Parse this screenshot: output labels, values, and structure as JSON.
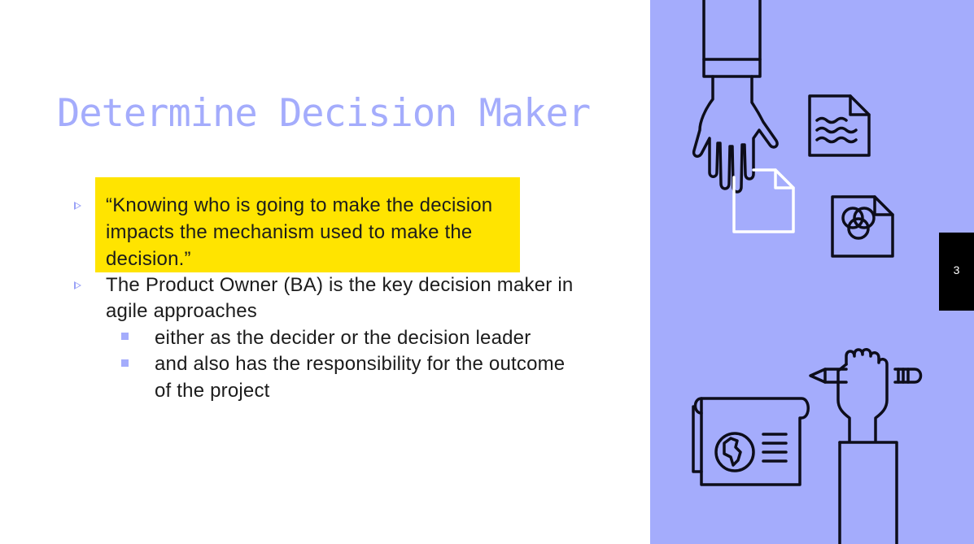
{
  "slide": {
    "title": "Determine Decision Maker",
    "page_number": "3",
    "bullets": [
      {
        "lines": [
          "“Knowing who is going to make the decision",
          "impacts the mechanism used to make the",
          "decision.”"
        ],
        "highlighted": true
      },
      {
        "lines": [
          "The Product Owner (BA) is the key decision maker in",
          "agile approaches"
        ],
        "highlighted": false,
        "sub_bullets": [
          {
            "lines": [
              "either as the decider or the decision leader"
            ]
          },
          {
            "lines": [
              "and also has the responsibility for the outcome",
              "of the project"
            ]
          }
        ]
      }
    ]
  },
  "colors": {
    "accent": "#a4acfc",
    "highlight": "#ffe400",
    "page_box": "#000000"
  },
  "icons": [
    "hand-reaching-icon",
    "document-icon",
    "blank-page-icon",
    "venn-document-icon",
    "hand-holding-pencil-icon",
    "world-map-scroll-icon"
  ]
}
